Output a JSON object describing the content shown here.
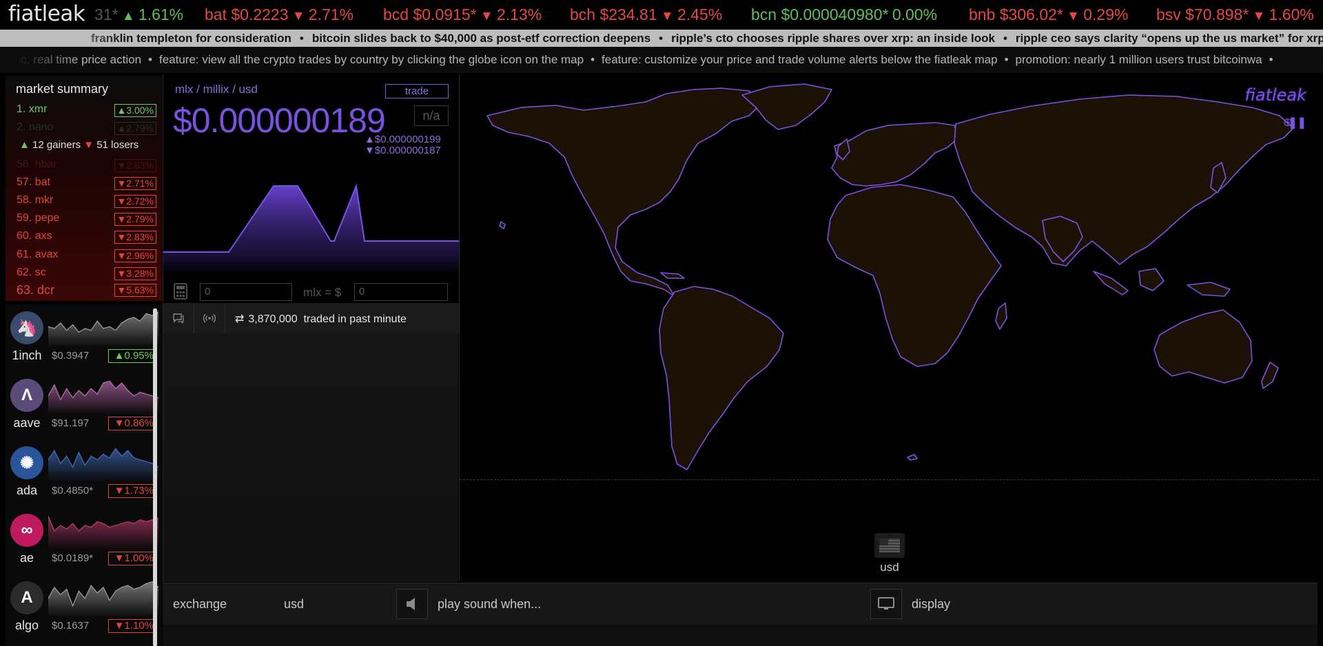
{
  "app": {
    "logo": "fiatleak"
  },
  "price_ticker": [
    {
      "text": "31*",
      "change": "1.61%",
      "dir": "up"
    },
    {
      "text": "bat $0.2223",
      "change": "2.71%",
      "dir": "down"
    },
    {
      "text": "bcd $0.0915*",
      "change": "2.13%",
      "dir": "down"
    },
    {
      "text": "bch $234.81",
      "change": "2.45%",
      "dir": "down"
    },
    {
      "text": "bcn $0.000040980*",
      "change": "0.00%",
      "dir": "flat"
    },
    {
      "text": "bnb $306.02*",
      "change": "0.29%",
      "dir": "down"
    },
    {
      "text": "bsv $70.898*",
      "change": "1.60%",
      "dir": "down"
    }
  ],
  "news_ticker": [
    "franklin templeton for consideration",
    "bitcoin slides back to $40,000 as post-etf correction deepens",
    "ripple’s cto chooses ripple shares over xrp: an inside look",
    "ripple ceo says clarity “opens up the us market” for xrp"
  ],
  "feature_ticker": [
    "ecific, real time price action",
    "feature: view all the crypto trades by country by clicking the globe icon on the map",
    "feature: customize your price and trade volume alerts below the fiatleak map",
    "promotion: nearly 1 million users trust bitcoinwa"
  ],
  "market_summary": {
    "title": "market summary",
    "gainers_count": "12 gainers",
    "losers_count": "51 losers",
    "top_rows": [
      {
        "name": "1. xmr",
        "pct": "▲3.00%",
        "dir": "up",
        "faded": false
      },
      {
        "name": "2. nano",
        "pct": "▲2.79%",
        "dir": "up",
        "faded": true
      }
    ],
    "rows": [
      {
        "name": "56. hbar",
        "pct": "▼2.63%",
        "dir": "down",
        "faded": true
      },
      {
        "name": "57. bat",
        "pct": "▼2.71%",
        "dir": "down",
        "faded": false
      },
      {
        "name": "58. mkr",
        "pct": "▼2.72%",
        "dir": "down",
        "faded": false
      },
      {
        "name": "59. pepe",
        "pct": "▼2.79%",
        "dir": "down",
        "faded": false
      },
      {
        "name": "60. axs",
        "pct": "▼2.83%",
        "dir": "down",
        "faded": false
      },
      {
        "name": "61. avax",
        "pct": "▼2.96%",
        "dir": "down",
        "faded": false
      },
      {
        "name": "62. sc",
        "pct": "▼3.28%",
        "dir": "down",
        "faded": false
      },
      {
        "name": "63. dcr",
        "pct": "▼5.63%",
        "dir": "down",
        "faded": false
      }
    ]
  },
  "coins": [
    {
      "symbol": "1inch",
      "price": "$0.3947",
      "change": "▲0.95%",
      "dir": "up",
      "logo_color": "#3a4a6b",
      "logo_icon": "unicorn-icon",
      "logo_glyph": "🦄",
      "spark_color": "#9a9a9a",
      "spark": [
        0.45,
        0.5,
        0.35,
        0.55,
        0.4,
        0.6,
        0.5,
        0.55,
        0.3,
        0.5,
        0.45,
        0.55,
        0.35,
        0.25,
        0.2,
        0.3,
        0.1,
        0.15,
        0.05
      ]
    },
    {
      "symbol": "aave",
      "price": "$91.197",
      "change": "▼0.86%",
      "dir": "down",
      "logo_color": "#5b4a7a",
      "logo_icon": "aave-a-icon",
      "logo_glyph": "Λ",
      "spark_color": "#b56aa8",
      "spark": [
        0.5,
        0.2,
        0.6,
        0.3,
        0.55,
        0.35,
        0.5,
        0.3,
        0.45,
        0.15,
        0.1,
        0.3,
        0.15,
        0.35,
        0.5,
        0.4,
        0.45,
        0.5,
        0.55
      ]
    },
    {
      "symbol": "ada",
      "price": "$0.4850*",
      "change": "▼1.73%",
      "dir": "down",
      "logo_color": "#2a5599",
      "logo_icon": "cardano-icon",
      "logo_glyph": "✺",
      "spark_color": "#3e6bb5",
      "spark": [
        0.4,
        0.15,
        0.5,
        0.3,
        0.6,
        0.2,
        0.55,
        0.3,
        0.4,
        0.25,
        0.35,
        0.1,
        0.3,
        0.15,
        0.35,
        0.4,
        0.45,
        0.5,
        0.6
      ]
    },
    {
      "symbol": "ae",
      "price": "$0.0189*",
      "change": "▼1.00%",
      "dir": "down",
      "logo_color": "#c01a5e",
      "logo_icon": "aeternity-icon",
      "logo_glyph": "∞",
      "spark_color": "#b53a6a",
      "spark": [
        0.1,
        0.5,
        0.35,
        0.45,
        0.3,
        0.5,
        0.35,
        0.4,
        0.25,
        0.3,
        0.4,
        0.35,
        0.3,
        0.25,
        0.3,
        0.2,
        0.25,
        0.2,
        0.15
      ]
    },
    {
      "symbol": "algo",
      "price": "$0.1637",
      "change": "▼1.10%",
      "dir": "down",
      "logo_color": "#2b2b2b",
      "logo_icon": "algorand-icon",
      "logo_glyph": "A",
      "spark_color": "#9a9a9a",
      "spark": [
        0.5,
        0.2,
        0.4,
        0.25,
        0.7,
        0.3,
        0.5,
        0.15,
        0.35,
        0.2,
        0.55,
        0.3,
        0.2,
        0.15,
        0.25,
        0.2,
        0.1,
        0.05,
        0.2
      ]
    }
  ],
  "detail": {
    "pair_path": "mlx / millix / usd",
    "trade_label": "trade",
    "price": "$0.000000189",
    "na_label": "n/a",
    "high": "▲$0.000000199",
    "low": "▼$0.000000187",
    "calc_left_value": "0",
    "calc_label": "mlx = $",
    "calc_right_value": "0",
    "chart_levels": [
      0.187,
      0.187,
      0.187,
      0.199,
      0.199,
      0.189,
      0.189,
      0.199,
      0.189,
      0.189
    ]
  },
  "feed": {
    "traded_count": "3,870,000",
    "traded_suffix": "traded in past minute"
  },
  "map": {
    "logo": "fiatleak",
    "currency": "usd"
  },
  "bottom": {
    "exchange_label": "exchange",
    "exchange_value": "usd",
    "sound_label": "play sound when...",
    "display_label": "display"
  },
  "colors": {
    "accent": "#7a52e2",
    "gain": "#6fca5a",
    "loss": "#e0453d",
    "land_fill": "#1c1105"
  }
}
